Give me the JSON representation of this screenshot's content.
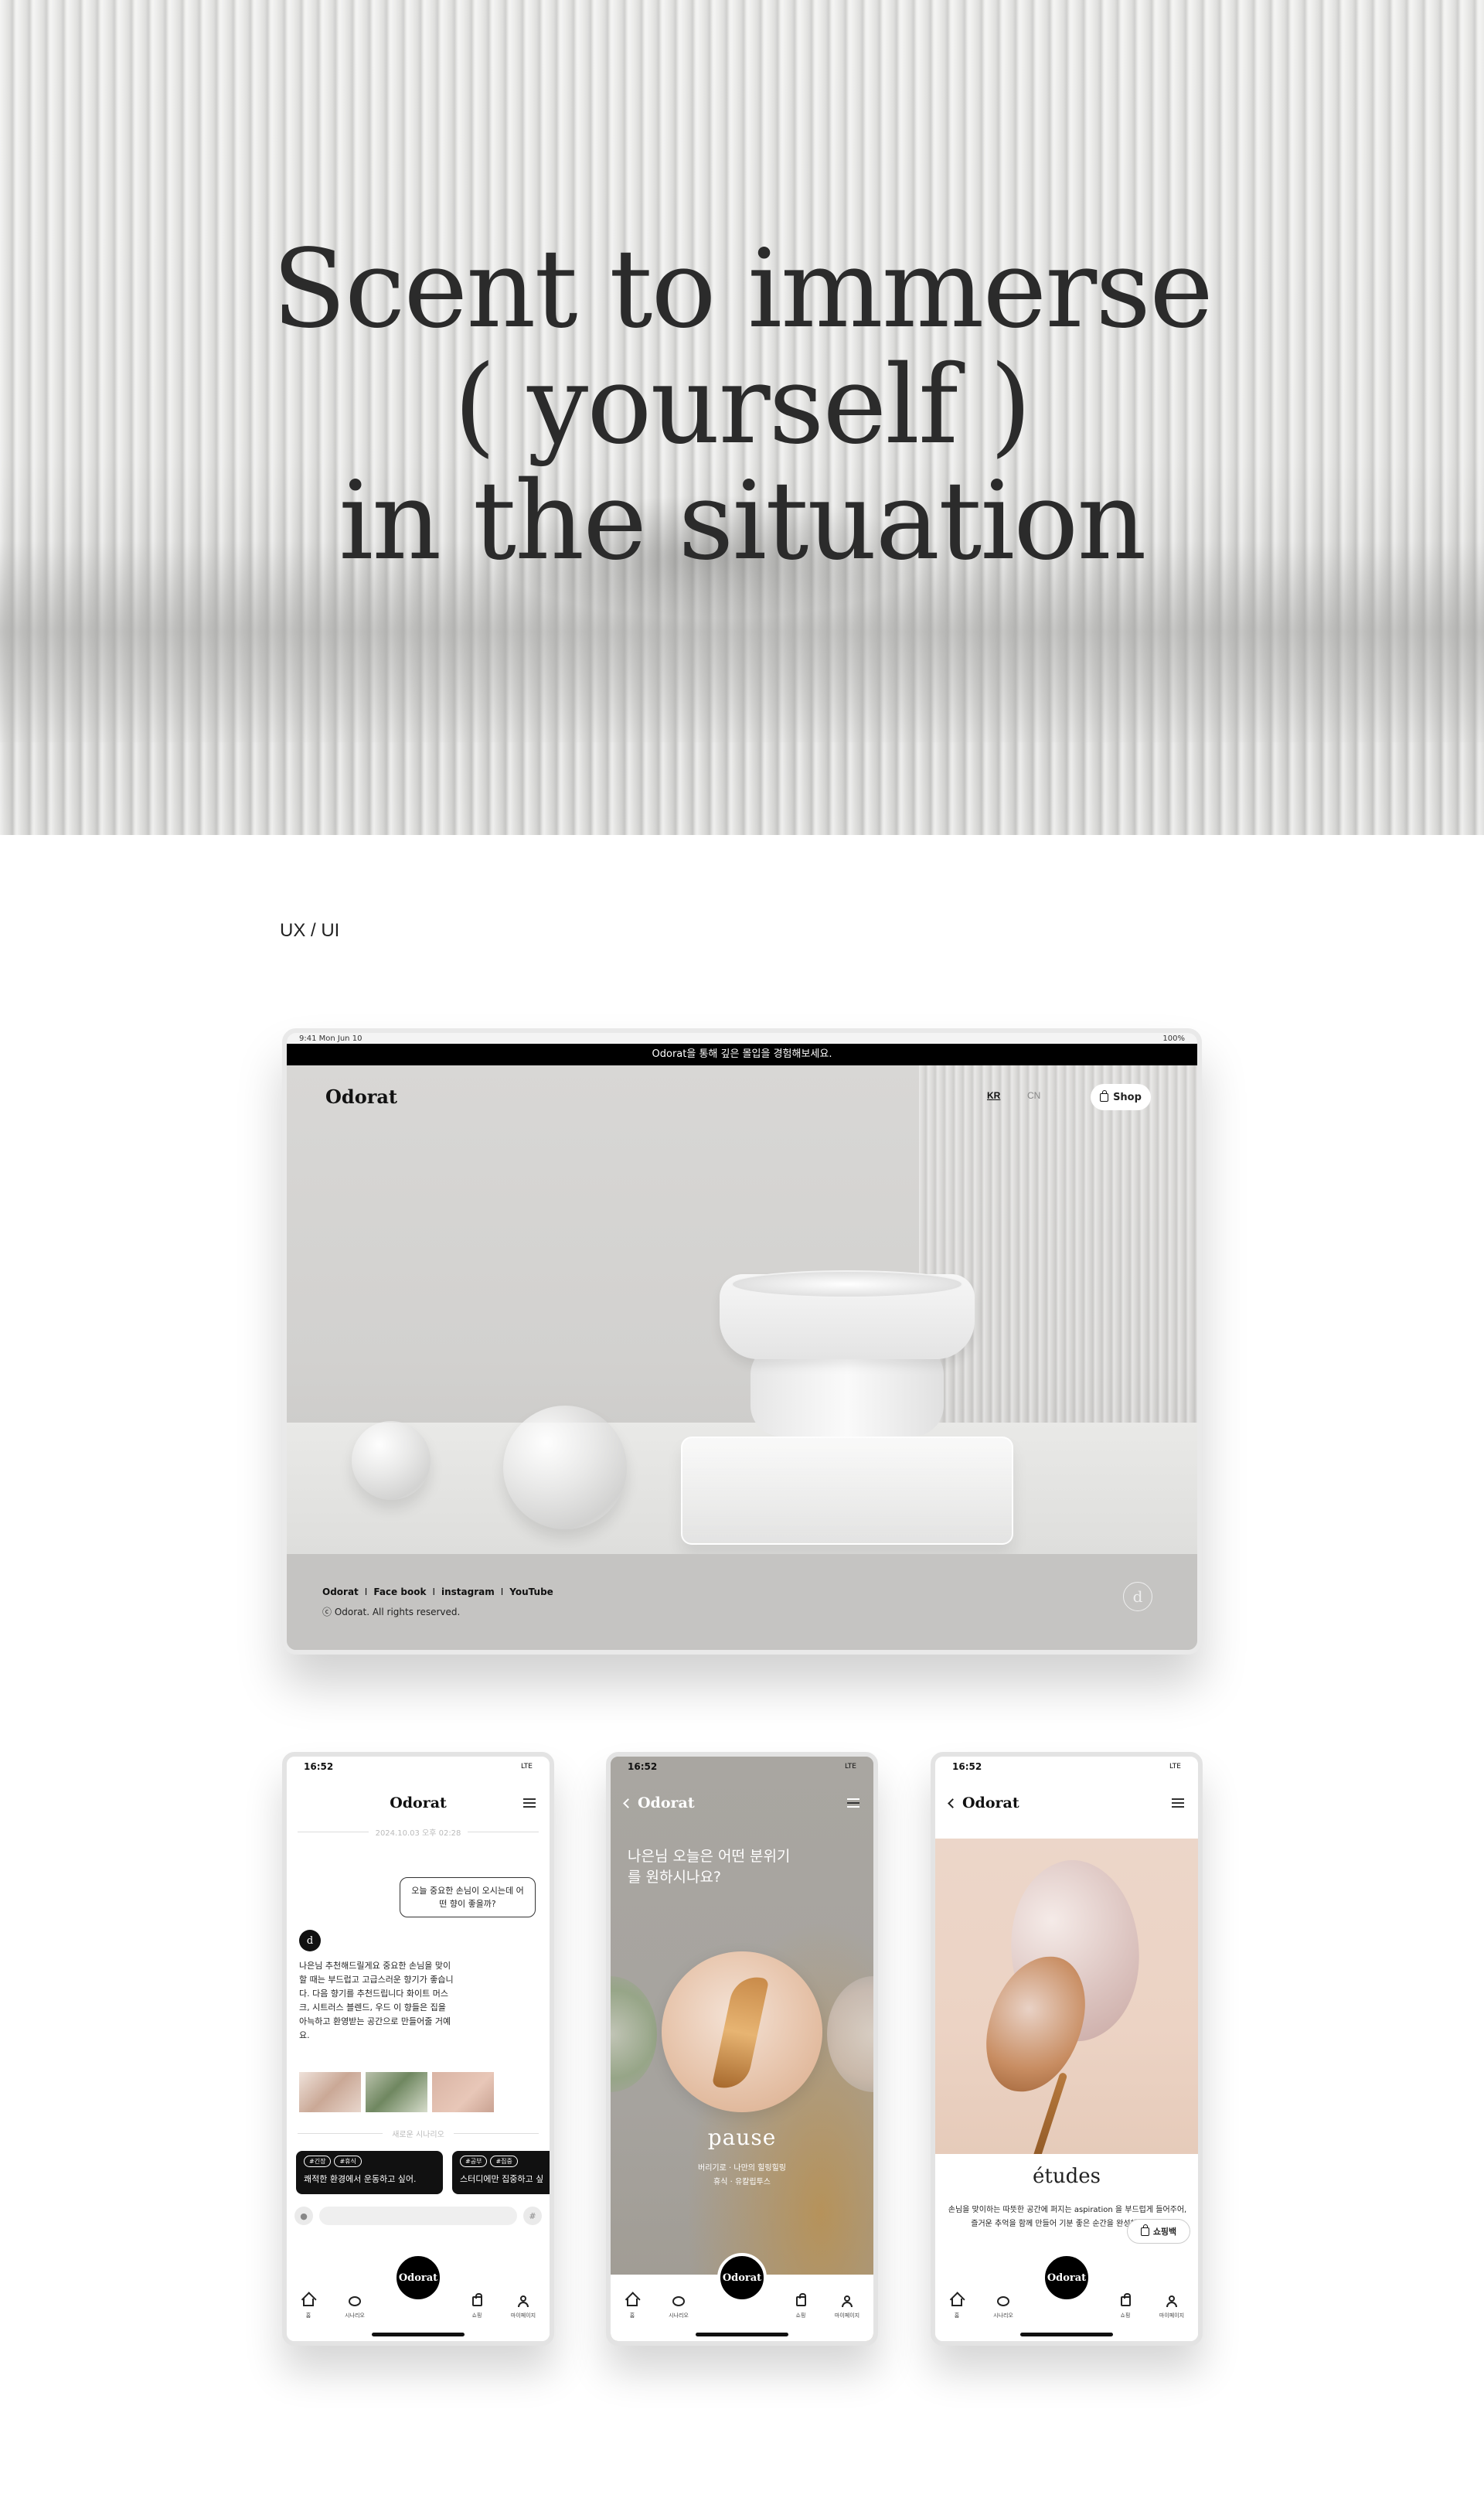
{
  "hero": {
    "line1": "Scent to immerse",
    "line2": "( yourself )",
    "line3": "in the situation"
  },
  "section_label": "UX / UI",
  "tablet": {
    "status_time": "9:41  Mon Jun 10",
    "status_right": "100%",
    "banner": "Odorat을 통해 깊은 몰입을 경험해보세요.",
    "logo": "Odorat",
    "lang_kr": "KR",
    "lang_cn": "CN",
    "shop_label": "Shop",
    "footer_links": [
      "Odorat",
      "Face book",
      "instagram",
      "YouTube"
    ],
    "footer_sep": "I",
    "copyright": "ⓒ Odorat. All rights reserved.",
    "badge": "d"
  },
  "phone_chat": {
    "time": "16:52",
    "net": "LTE",
    "title": "Odorat",
    "date": "2024.10.03 오후 02:28",
    "user_msg": "오늘 중요한 손님이 오시는데 어떤 향이 좋을까?",
    "bot_avatar": "d",
    "bot_msg": "나은님 추천해드릴게요 중요한 손님을 맞이할 때는 부드럽고 고급스러운 향기가 좋습니다. 다음 향기를 추천드립니다 화이트 머스크, 시트러스 블렌드, 우드 이 향들은 집을 아늑하고 환영받는 공간으로 만들어줄 거예요.",
    "new_scenario": "새로운 시나리오",
    "cards": [
      {
        "tags": [
          "#긴장",
          "#휴식"
        ],
        "text": "쾌적한 환경에서 운동하고 싶어."
      },
      {
        "tags": [
          "#공부",
          "#집중"
        ],
        "text": "스터디에만 집중하고 싶"
      }
    ],
    "mic_icon": "mic-icon",
    "hash_icon": "#"
  },
  "phone_pause": {
    "time": "16:52",
    "net": "LTE",
    "title": "Odorat",
    "question": "나은님 오늘은 어떤 분위기를 원하시나요?",
    "word": "pause",
    "sub1": "버리기로 · 나만의 힐링힐링",
    "sub2": "휴식 · 유칼립투스"
  },
  "phone_etudes": {
    "time": "16:52",
    "net": "LTE",
    "title": "Odorat",
    "word": "études",
    "desc": "손님을 맞이하는 따뜻한 공간에 퍼지는 aspiration 을 부드럽게 들어주어, 즐거운 추억을 함께 만들어 기분 좋은 순간을 완성해 줍니다.",
    "shop_label": "쇼핑백"
  },
  "bottom_nav": {
    "home": "홈",
    "chat": "시나리오",
    "center": "Odorat",
    "shop": "쇼핑",
    "my": "마이페이지"
  }
}
